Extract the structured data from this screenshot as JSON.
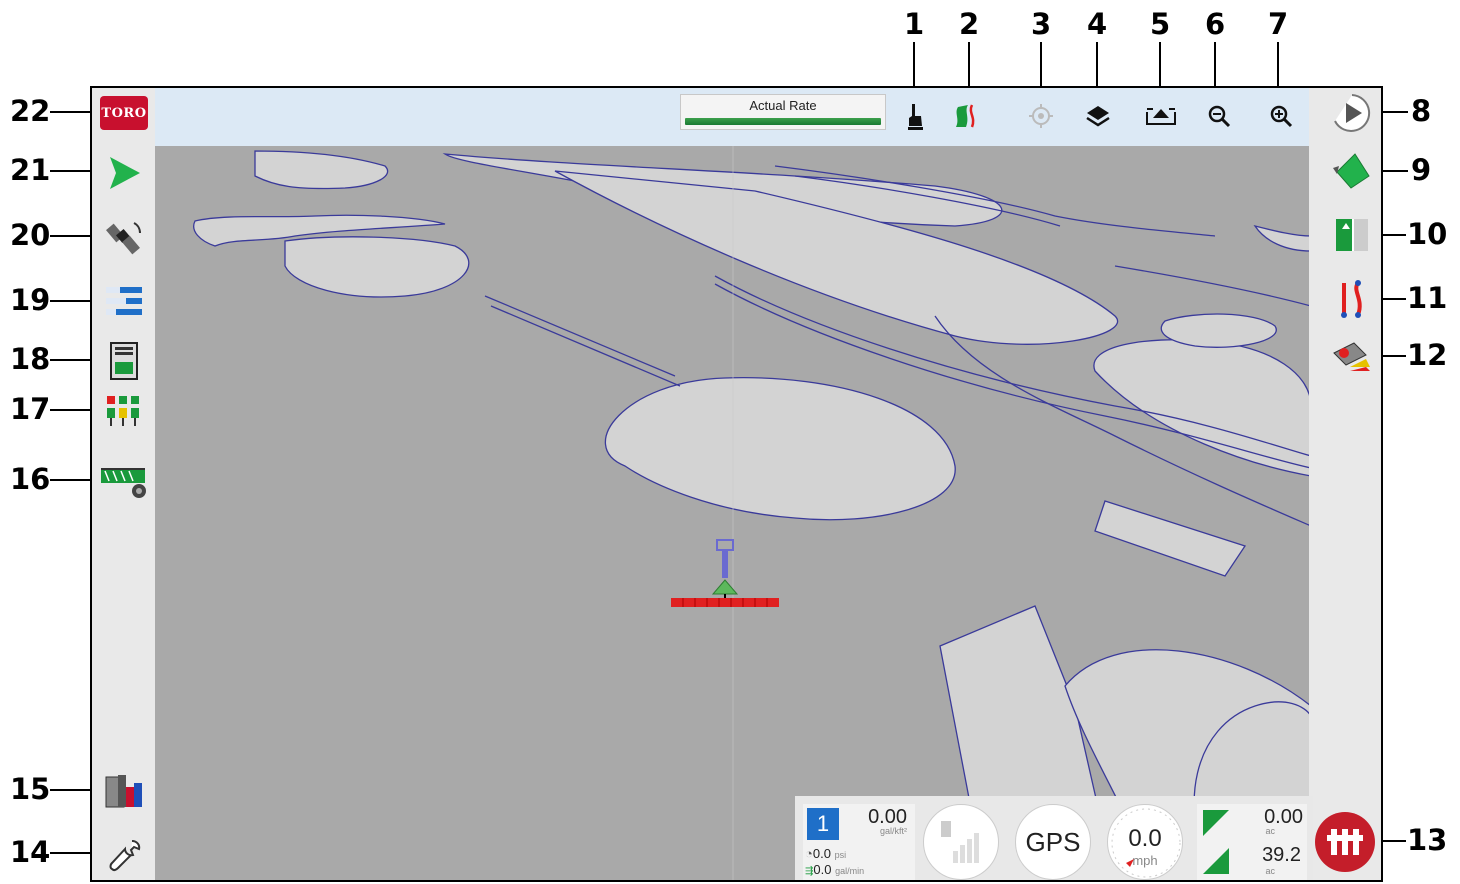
{
  "callouts": {
    "c1": "1",
    "c2": "2",
    "c3": "3",
    "c4": "4",
    "c5": "5",
    "c6": "6",
    "c7": "7",
    "c8": "8",
    "c9": "9",
    "c10": "10",
    "c11": "11",
    "c12": "12",
    "c13": "13",
    "c14": "14",
    "c15": "15",
    "c16": "16",
    "c17": "17",
    "c18": "18",
    "c19": "19",
    "c20": "20",
    "c21": "21",
    "c22": "22"
  },
  "brand": {
    "logo_text": "TORO",
    "color": "#c8102e"
  },
  "top_bar": {
    "rate_label": "Actual Rate"
  },
  "icons": {
    "left": [
      "toro-logo-icon",
      "guidance-arrow-icon",
      "satellite-icon",
      "list-icon",
      "console-icon",
      "section-control-icon",
      "sprayer-icon",
      "tank-icon",
      "wrench-icon"
    ],
    "top": [
      "hand-pointer-icon",
      "coverage-icon",
      "center-target-icon",
      "layers-icon",
      "view-mode-icon",
      "zoom-out-icon",
      "zoom-in-icon"
    ],
    "right": [
      "play-icon",
      "field-icon",
      "area-icon",
      "boundary-icon",
      "rate-icon",
      "master-switch-icon"
    ]
  },
  "dashboard": {
    "section_number": "1",
    "rate_value": "0.00",
    "rate_unit": "gal/kft²",
    "pressure_value": "0.0",
    "pressure_unit": "psi",
    "flow_value": "0.0",
    "flow_unit": "gal/min",
    "gps_label": "GPS",
    "speed_value": "0.0",
    "speed_unit": "mph",
    "area_1_value": "0.00",
    "area_1_unit": "ac",
    "area_2_value": "39.2",
    "area_2_unit": "ac"
  },
  "colors": {
    "map_ground": "#a9a9a9",
    "map_shape": "#d3d3d3",
    "outline": "#3a3a9a",
    "accent_green": "#1a9a3c",
    "boom_red": "#e02020"
  }
}
